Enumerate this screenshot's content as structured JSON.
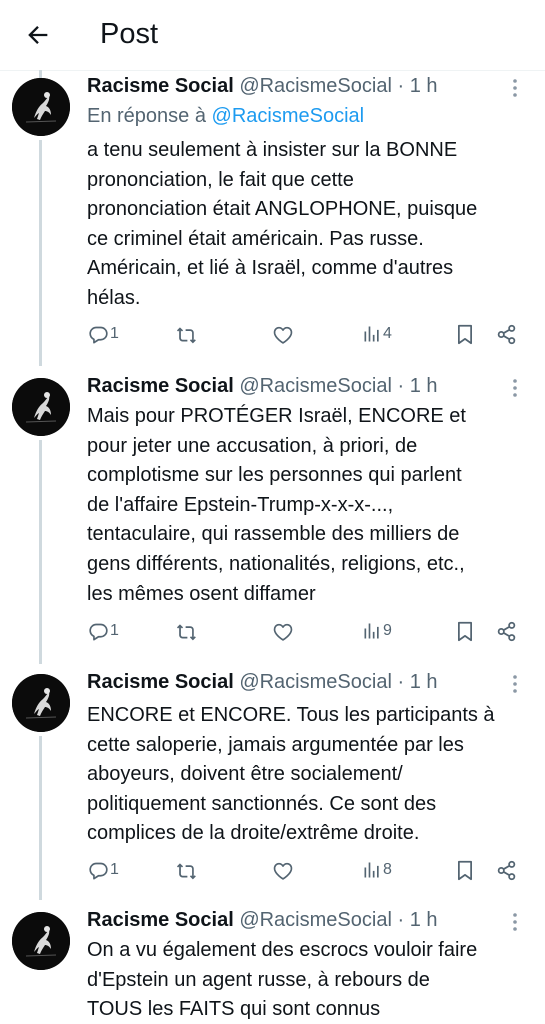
{
  "header": {
    "title": "Post",
    "back_icon": "arrow-left-icon"
  },
  "tweets": [
    {
      "name": "Racisme Social",
      "handle": "@RacismeSocial",
      "dot": "·",
      "time": "1 h",
      "reply_prefix": "En réponse à ",
      "reply_to": "@RacismeSocial",
      "text": "a tenu seulement à insister sur la BONNE\nprononciation, le fait que cette\nprononciation était ANGLOPHONE, puisque\nce criminel était américain. Pas russe.\nAméricain, et lié à Israël, comme d'autres\nhélas.",
      "replies": "1",
      "views": "4"
    },
    {
      "name": "Racisme Social",
      "handle": "@RacismeSocial",
      "dot": "·",
      "time": "1 h",
      "text": "Mais pour PROTÉGER Israël, ENCORE et\npour jeter une accusation, à priori, de\ncomplotisme sur les personnes qui parlent\nde l'affaire Epstein-Trump-x-x-x-...,\ntentaculaire, qui rassemble des milliers de\ngens différents, nationalités, religions, etc.,\nles mêmes osent diffamer",
      "replies": "1",
      "views": "9"
    },
    {
      "name": "Racisme Social",
      "handle": "@RacismeSocial",
      "dot": "·",
      "time": "1 h",
      "text": "ENCORE et ENCORE. Tous les participants à\ncette saloperie, jamais argumentée par les\naboyeurs, doivent être socialement/\npolitiquement sanctionnés. Ce sont des\ncomplices de la droite/extrême droite.",
      "replies": "1",
      "views": "8"
    },
    {
      "name": "Racisme Social",
      "handle": "@RacismeSocial",
      "dot": "·",
      "time": "1 h",
      "text": "On a vu également des escrocs vouloir faire\nd'Epstein un agent russe, à rebours de\nTOUS les FAITS qui sont connus"
    }
  ],
  "colors": {
    "text": "#0f1419",
    "secondary": "#536471",
    "link": "#1d9bf0",
    "thread_line": "#cfd9de",
    "divider": "#eff3f4"
  },
  "icons": {
    "reply": "reply-icon",
    "retweet": "retweet-icon",
    "like": "heart-icon",
    "views": "views-icon",
    "bookmark": "bookmark-icon",
    "share": "share-icon",
    "more": "more-vertical-icon"
  }
}
